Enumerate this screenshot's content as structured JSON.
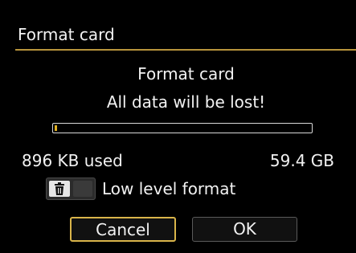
{
  "header": {
    "title": "Format card"
  },
  "dialog": {
    "heading": "Format card",
    "warning": "All data will be lost!",
    "progress_fraction": 0.003,
    "used_text": "896 KB used",
    "total_text": "59.4 GB",
    "low_level_format": {
      "label": "Low level format",
      "enabled": false,
      "icon": "trash-icon"
    },
    "buttons": {
      "cancel_label": "Cancel",
      "ok_label": "OK"
    }
  },
  "colors": {
    "background": "#000000",
    "accent": "#b8943c",
    "progress_fill": "#e0b020",
    "text": "#f2f2f2"
  }
}
